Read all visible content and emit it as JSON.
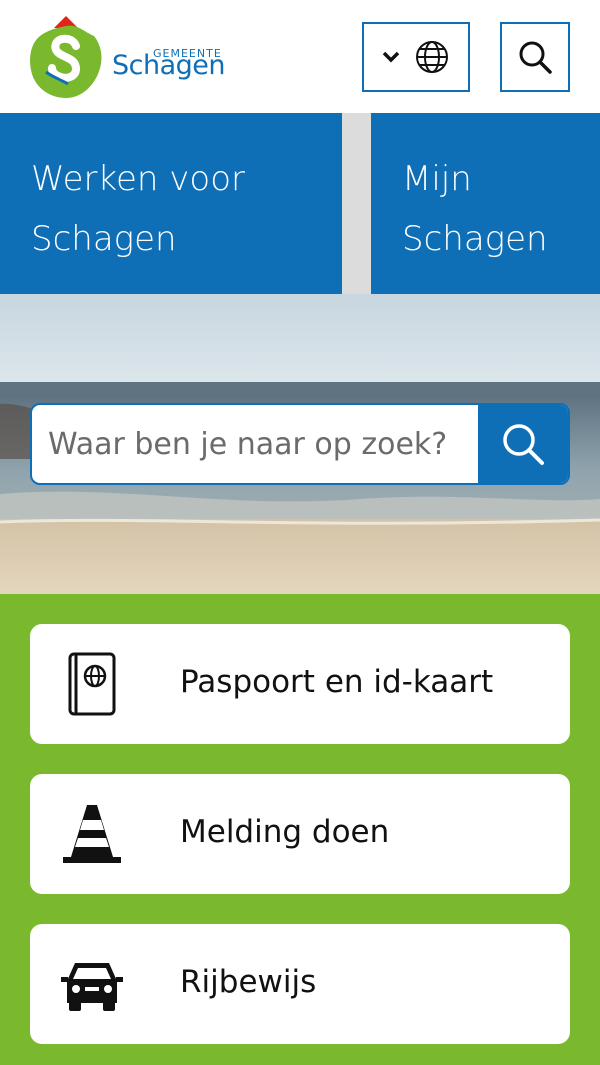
{
  "header": {
    "logo_small": "GEMEENTE",
    "logo_big": "Schagen",
    "lang_icons": [
      "chevron-down-icon",
      "globe-icon"
    ],
    "search_icon": "search-icon"
  },
  "tiles": [
    {
      "line1": "Werken voor",
      "line2": "Schagen"
    },
    {
      "line1": "Mijn",
      "line2": "Schagen"
    }
  ],
  "hero": {
    "search_placeholder": "Waar ben je naar op zoek?",
    "search_icon": "search-icon"
  },
  "quick_links": [
    {
      "label": "Paspoort en id-kaart",
      "icon": "passport-icon"
    },
    {
      "label": "Melding doen",
      "icon": "traffic-cone-icon"
    },
    {
      "label": "Rijbewijs",
      "icon": "car-icon"
    }
  ],
  "colors": {
    "brand_blue": "#0f6fb6",
    "brand_green": "#7ab92e",
    "logo_red": "#e2231a"
  }
}
